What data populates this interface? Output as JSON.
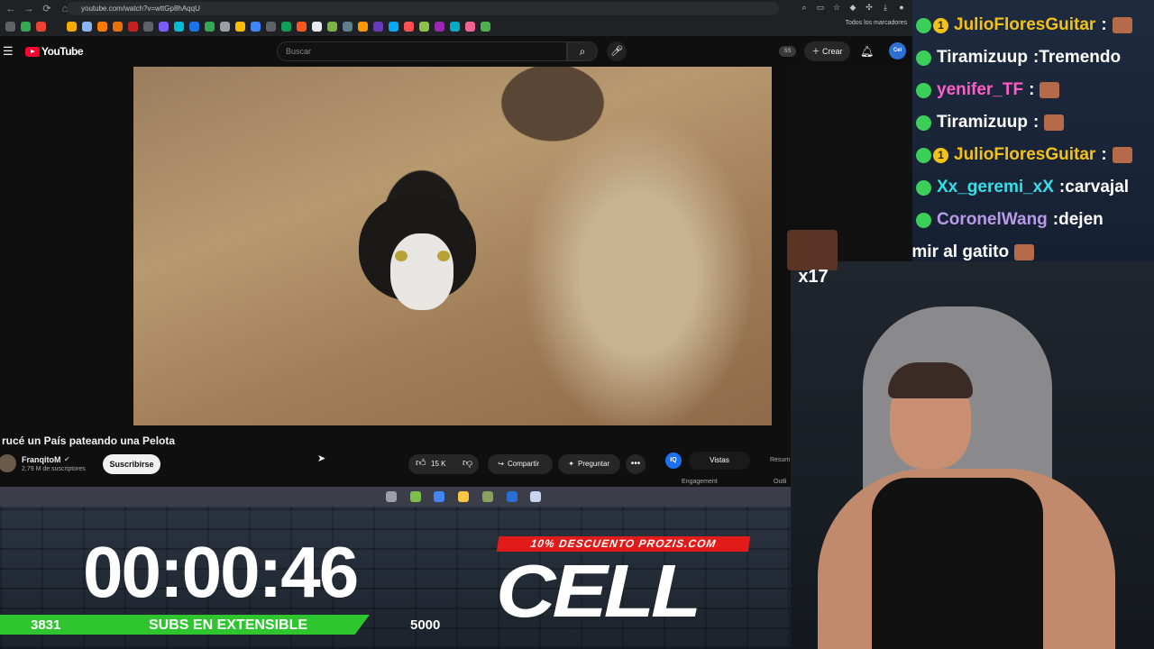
{
  "browser": {
    "url": "youtube.com/watch?v=wttGp8hAqqU",
    "bookmarks_folder": "Todos los marcadores",
    "bookmark_colors": [
      "#5f6368",
      "#34a853",
      "#ea4335",
      "#202124",
      "#f9ab00",
      "#8ab4f8",
      "#ff7a00",
      "#e8710a",
      "#c5221f",
      "#5f6368",
      "#7b5cff",
      "#00bcd4",
      "#1a73e8",
      "#34a853",
      "#9aa0a6",
      "#fbbc04",
      "#4285f4",
      "#5f6368",
      "#0f9d58",
      "#ff5722",
      "#e8eaed",
      "#7cb342",
      "#607d8b",
      "#ff9800",
      "#673ab7",
      "#03a9f4",
      "#ff5252",
      "#8bc34a",
      "#9c27b0",
      "#00acc1",
      "#f06292",
      "#4caf50"
    ]
  },
  "youtube": {
    "logo_text": "YouTube",
    "search_placeholder": "Buscar",
    "ss_badge": "SS",
    "create_label": "Crear",
    "avatar_text": "Cel",
    "video": {
      "title": "rucé un País pateando una Pelota",
      "channel": "FranqitoM",
      "subscribers": "2,79 M de suscriptores",
      "subscribe_label": "Suscribirse",
      "likes": "15 K",
      "share_label": "Compartir",
      "ask_label": "Preguntar"
    },
    "panel": {
      "logo_text": "IQ",
      "tab_views": "Vistas",
      "tab_summary": "Resum",
      "engagement": "Engagement",
      "outline": "Outli"
    }
  },
  "taskbar": {
    "icon_colors": [
      "#9aa0a6",
      "#7cc04a",
      "#4285f4",
      "#f9c543",
      "#8aa060",
      "#2a6fd6",
      "#c9d6f2"
    ]
  },
  "overlay": {
    "timer": "00:00:46",
    "subs_current": "3831",
    "subs_label": "SUBS EN EXTENSIBLE",
    "subs_goal": "5000",
    "promo_banner": "10% DESCUENTO PROZIS.COM",
    "promo_brand": "CELL",
    "emote_count": "x17"
  },
  "chat": [
    {
      "user": "JulioFloresGuitar",
      "color": "#f2c21a",
      "subscriber": true,
      "message": "",
      "emote": true
    },
    {
      "user": "Tiramizuup",
      "color": "#ffffff",
      "subscriber": false,
      "message": "Tremendo",
      "emote": false
    },
    {
      "user": "yenifer_TF",
      "color": "#ff5cc8",
      "subscriber": false,
      "message": "",
      "emote": true
    },
    {
      "user": "Tiramizuup",
      "color": "#ffffff",
      "subscriber": false,
      "message": "",
      "emote": true
    },
    {
      "user": "JulioFloresGuitar",
      "color": "#f2c21a",
      "subscriber": true,
      "message": "",
      "emote": true
    },
    {
      "user": "Xx_geremi_xX",
      "color": "#35e0e8",
      "subscriber": false,
      "message": "carvajal",
      "emote": false
    },
    {
      "user": "CoronelWang",
      "color": "#b99ae6",
      "subscriber": false,
      "message": "dejen",
      "emote": false
    },
    {
      "user": "",
      "color": "#ffffff",
      "subscriber": false,
      "message": "rmir al gatito",
      "emote": true
    }
  ]
}
